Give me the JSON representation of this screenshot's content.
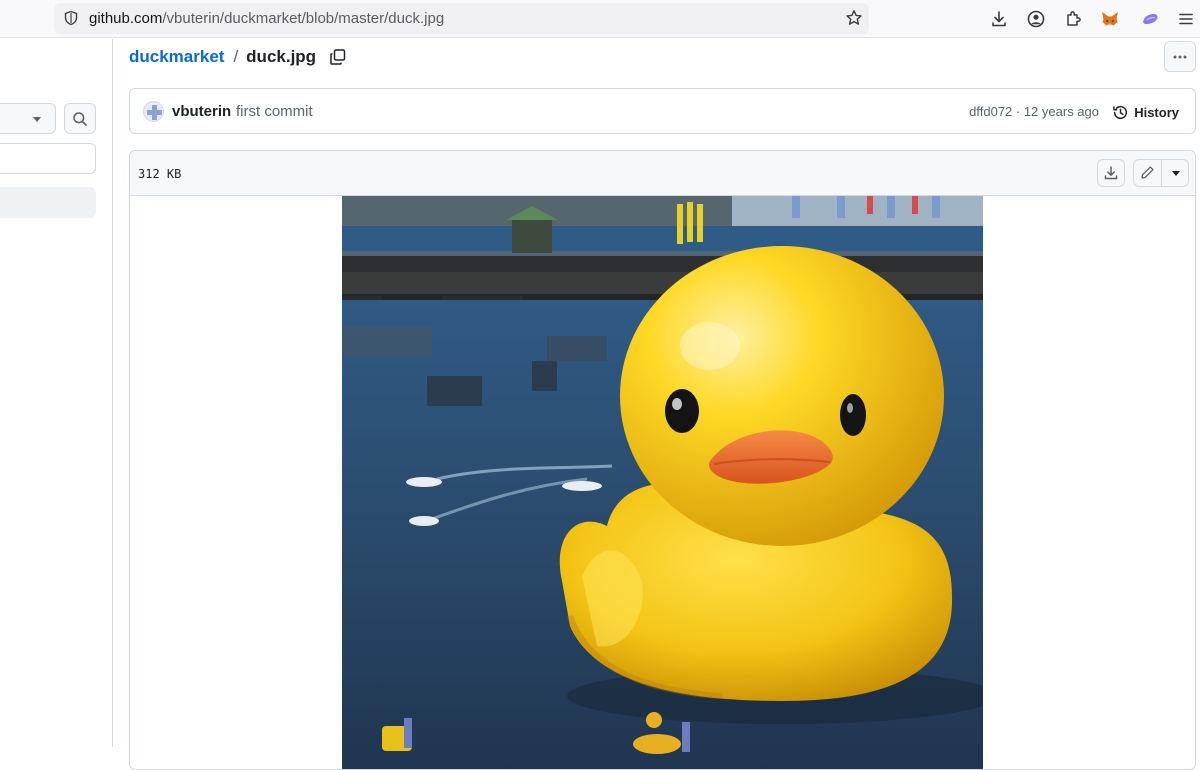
{
  "browser": {
    "url_host": "github.com",
    "url_path": "/vbuterin/duckmarket/blob/master/duck.jpg",
    "icons": [
      "shield-icon",
      "bookmark-star-icon",
      "downloads-icon",
      "account-icon",
      "extensions-icon",
      "metamask-fox-icon",
      "extension-icon",
      "menu-icon"
    ]
  },
  "breadcrumb": {
    "repo": "duckmarket",
    "separator": "/",
    "file": "duck.jpg"
  },
  "commit": {
    "author": "vbuterin",
    "message": "first commit",
    "meta": "dffd072 · 12 years ago",
    "history_label": "History"
  },
  "file": {
    "size": "312 KB",
    "image_subject": "giant yellow rubber duck floating in a harbor"
  },
  "colors": {
    "link": "#0969da",
    "border": "#d1d9e0",
    "header_bg": "#f6f8fa",
    "duck_yellow": "#f4c81a",
    "water": "#2d4d6e"
  }
}
